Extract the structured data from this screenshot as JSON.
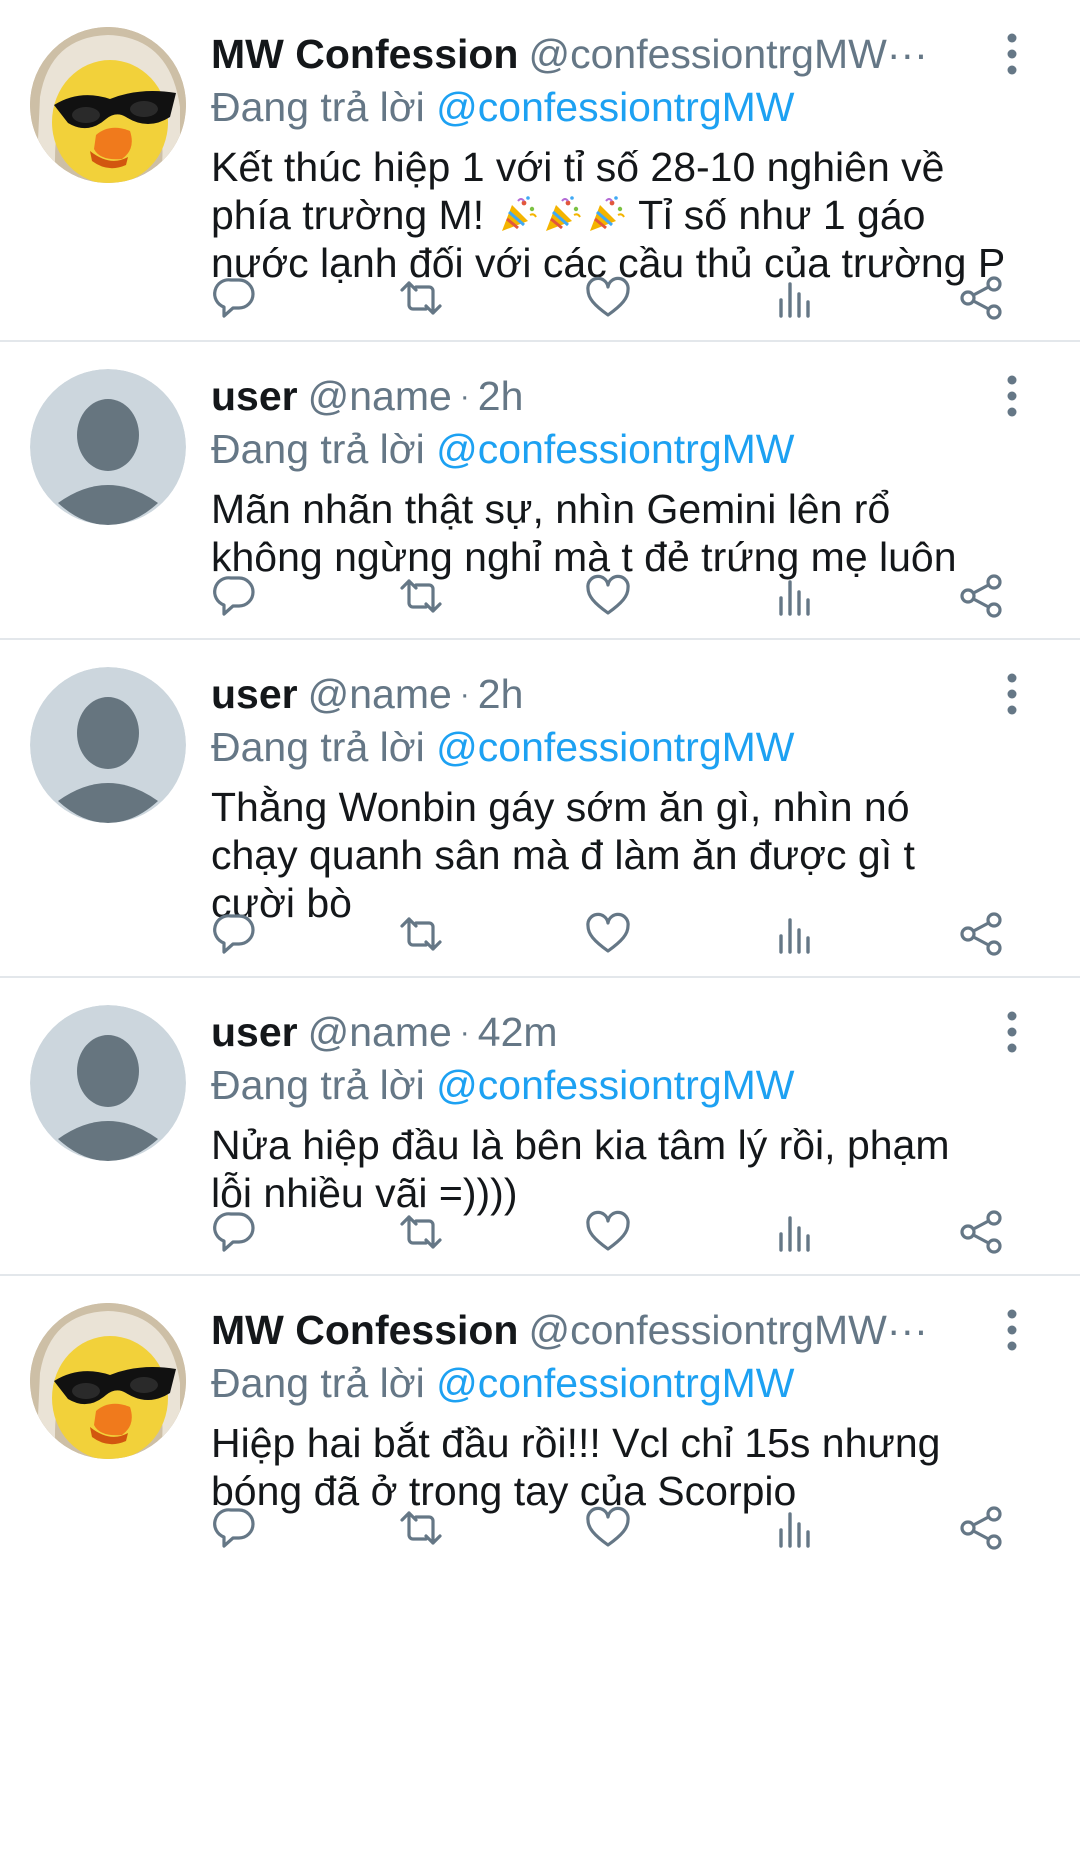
{
  "labels": {
    "replying_prefix": "Đang trả lời",
    "separator": "·",
    "ellipsis": "···"
  },
  "icons": [
    "reply-icon",
    "retweet-icon",
    "like-icon",
    "analytics-icon",
    "share-icon",
    "more-options-icon",
    "party-popper-icon"
  ],
  "colors": {
    "mention": "#1da1f2",
    "secondary_text": "#657786",
    "primary_text": "#14171a",
    "divider": "#e3e7eb"
  },
  "tweets": [
    {
      "name": "MW Confession",
      "handle": "@confessiontrgMW",
      "time": "",
      "reply_to": "@confessiontrgMW",
      "lines": [
        "Kết thúc hiệp 1 với tỉ số 28-10 nghiên về",
        "phía trường M! 🎉🎉🎉 Tỉ số như 1 gáo",
        "nước lạnh đối với các cầu thủ của trường P"
      ]
    },
    {
      "name": "user",
      "handle": "@name",
      "time": "2h",
      "reply_to": "@confessiontrgMW",
      "lines": [
        "Mãn nhãn thật sự, nhìn Gemini lên rổ",
        "không ngừng nghỉ mà t đẻ trứng mẹ luôn"
      ]
    },
    {
      "name": "user",
      "handle": "@name",
      "time": "2h",
      "reply_to": "@confessiontrgMW",
      "lines": [
        "Thằng Wonbin gáy sớm ăn gì, nhìn nó",
        "chạy quanh sân mà đ làm ăn được gì t",
        "cười bò"
      ]
    },
    {
      "name": "user",
      "handle": "@name",
      "time": "42m",
      "reply_to": "@confessiontrgMW",
      "lines": [
        "Nửa hiệp đầu là bên kia tâm lý rồi, phạm",
        "lỗi nhiều vãi =))))"
      ]
    },
    {
      "name": "MW Confession",
      "handle": "@confessiontrgMW",
      "time": "",
      "reply_to": "@confessiontrgMW",
      "lines": [
        "Hiệp hai bắt đầu rồi!!! Vcl chỉ 15s nhưng",
        "bóng đã ở trong tay của Scorpio"
      ]
    }
  ]
}
